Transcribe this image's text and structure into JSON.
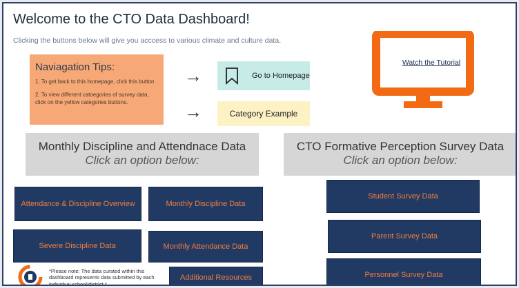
{
  "header": {
    "title": "Welcome to the CTO Data Dashboard!",
    "subtitle": "Clicking the buttons below will give you acccess to various climate and culture data."
  },
  "tips": {
    "heading": "Naviagation Tips:",
    "tip1": "1. To get back to this homepage, click this button",
    "tip2": "2. To view different catoegories of survey data, click on the yellow categories buttons."
  },
  "legend": {
    "home_label": "Go to Homepage",
    "category_label": "Category Example"
  },
  "tutorial": {
    "link_label": "Watch the Tutorial"
  },
  "sections": {
    "discipline": {
      "heading": "Monthly Discipline and Attendnace Data",
      "sub": "Click an option below:"
    },
    "survey": {
      "heading": "CTO Formative Perception Survey Data",
      "sub": "Click an option below:"
    }
  },
  "buttons": {
    "attendance_overview": "Attendance & Discipline Overview",
    "monthly_discipline": "Monthly Discipline Data",
    "severe_discipline": "Severe Discipline Data",
    "monthly_attendance": "Monthly Attendance Data",
    "additional_resources": "Additional Resources",
    "student_survey": "Student Survey Data",
    "parent_survey": "Parent Survey Data",
    "personnel_survey": "Personnel Survey Data"
  },
  "footer": {
    "note": "*Please note: The data curated within this dashboard represents data submitted by each individual school/district.*"
  },
  "colors": {
    "navy": "#213a63",
    "orange": "#f47c3c",
    "tips_bg": "#f7a877",
    "home_bg": "#c7ece7",
    "category_bg": "#fdf2c4",
    "monitor": "#f26a13"
  },
  "icons": {
    "arrow": "right-arrow-icon",
    "home": "bookmark-icon",
    "monitor": "monitor-icon",
    "logo": "cto-logo-icon"
  }
}
